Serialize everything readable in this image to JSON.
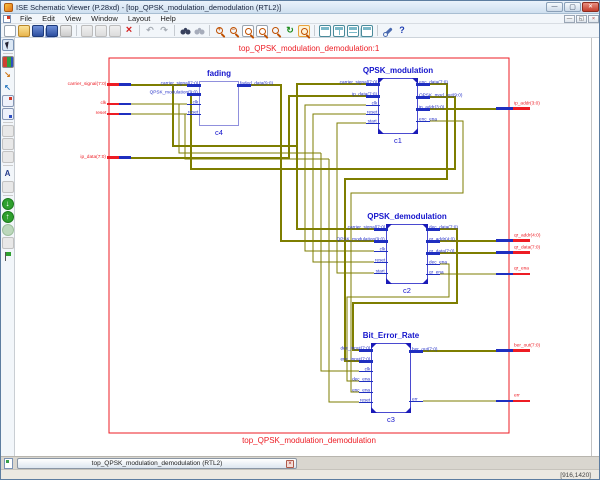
{
  "window": {
    "title": "ISE Schematic Viewer (P.28xd) - [top_QPSK_modulation_demodulation (RTL2)]"
  },
  "menu": {
    "items": [
      "File",
      "Edit",
      "View",
      "Window",
      "Layout",
      "Help"
    ]
  },
  "toolbar": {
    "buttons": [
      "new-file",
      "open-file",
      "save",
      "save-all",
      "print",
      "cut",
      "copy",
      "paste",
      "delete",
      "undo",
      "redo",
      "find",
      "find-next",
      "zoom-in",
      "zoom-out",
      "zoom-page",
      "zoom-fit",
      "zoom-selection",
      "refresh",
      "pan",
      "new-view",
      "split-view",
      "tile-view",
      "cascade-view",
      "preferences",
      "context-help"
    ]
  },
  "side_toolbar": {
    "buttons": [
      "select",
      "view-hierarchy",
      "push-into-block",
      "pop-out-block",
      "open-source",
      "add-view",
      "view-objects",
      "view-nets",
      "window-disabled",
      "find-objects",
      "trace-disabled",
      "next-instance",
      "previous-instance",
      "history-back",
      "history-forward",
      "add-marker"
    ]
  },
  "schematic": {
    "top_label": "top_QPSK_modulation_demodulation:1",
    "bottom_label": "top_QPSK_modulation_demodulation",
    "colors": {
      "wire": "#7e7e00",
      "port": "#ed1c24",
      "block": "#2430c8",
      "canvas": "#ffffff"
    },
    "left_ports": [
      {
        "label": "carrier_signal(7:0)"
      },
      {
        "label": "clk"
      },
      {
        "label": "reset"
      },
      {
        "label": "ip_data(7:0)"
      }
    ],
    "right_ports": [
      {
        "label": "ip_addr(3:0)"
      },
      {
        "label": "qr_addr(4:0)"
      },
      {
        "label": "qr_data(7:0)"
      },
      {
        "label": "qr_ena"
      },
      {
        "label": "ber_out(7:0)"
      },
      {
        "label": "err"
      }
    ],
    "blocks": [
      {
        "title": "fading",
        "instance": "c4",
        "left_pins": [
          "carrier_signal(7:0)",
          "QPSK_modulation(9:0)",
          "clk",
          "reset"
        ],
        "right_pins": [
          "faded_data(9:0)"
        ]
      },
      {
        "title": "QPSK_modulation",
        "instance": "c1",
        "left_pins": [
          "carrier_signal(7:0)",
          "ip_data(7:0)",
          "clk",
          "reset",
          "start"
        ],
        "right_pins": [
          "enc_data(7:0)",
          "QPSK_mod_out(9:0)",
          "ip_addr(3:0)",
          "enc_ena"
        ]
      },
      {
        "title": "QPSK_demodulation",
        "instance": "c2",
        "left_pins": [
          "carrier_signal(7:0)",
          "QPSK_modulation(9:0)",
          "clk",
          "reset",
          "start"
        ],
        "right_pins": [
          "dec_data(7:0)",
          "qr_addr(4:0)",
          "qr_data(7:0)",
          "dec_ena",
          "qr_ena"
        ]
      },
      {
        "title": "Bit_Error_Rate",
        "instance": "c3",
        "left_pins": [
          "dec_input(7:0)",
          "enc_input(7:0)",
          "clk",
          "dec_ena",
          "enc_ena",
          "reset"
        ],
        "right_pins": [
          "ber_out(7:0)",
          "err"
        ]
      }
    ]
  },
  "bottom": {
    "tab_label": "top_QPSK_modulation_demodulation (RTL2)",
    "status_right": "[916,1420]"
  }
}
